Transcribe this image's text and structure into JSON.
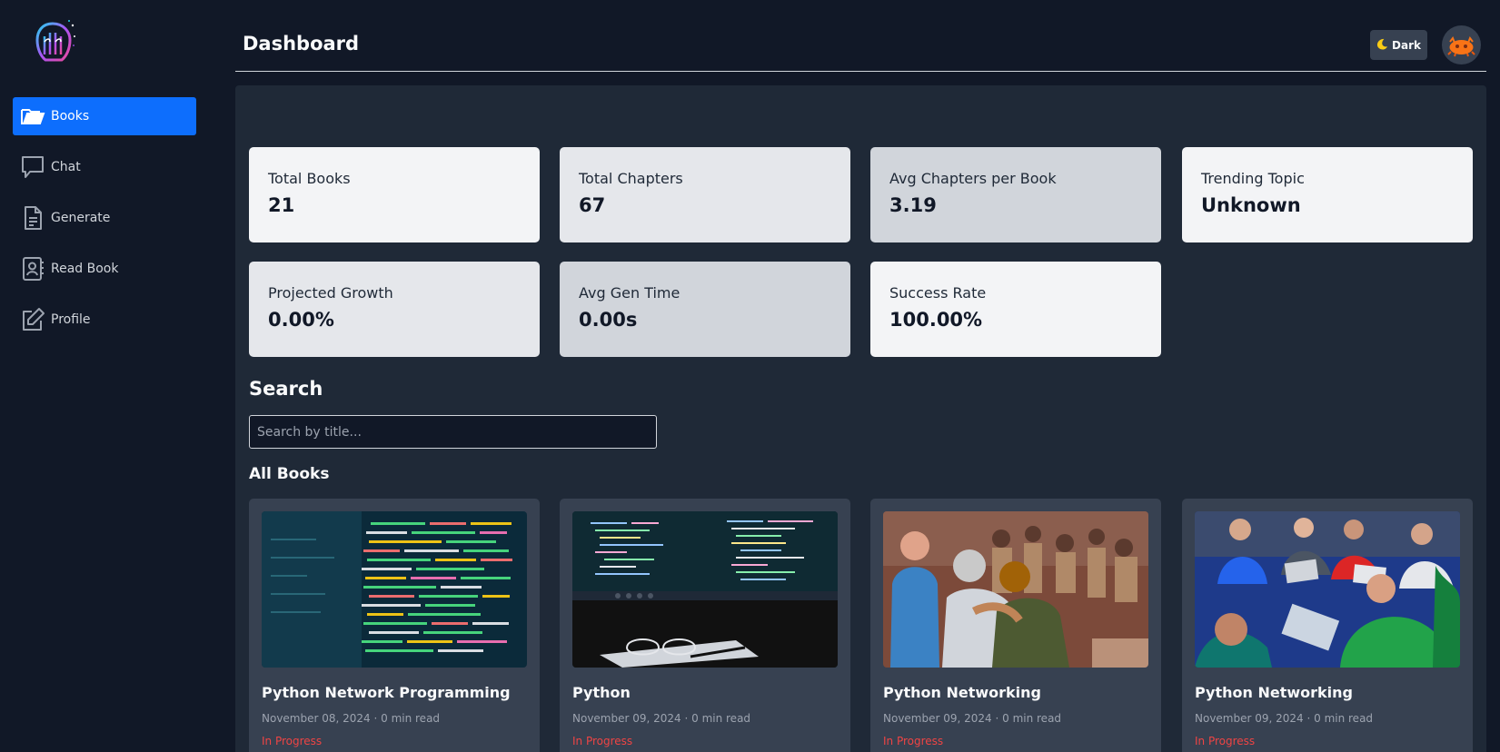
{
  "colors": {
    "accent": "#0d6efd",
    "status_in_progress": "#ef4444",
    "background": "#111827",
    "panel": "#1f2937"
  },
  "sidebar": {
    "logo_icon": "brain-circuit-logo",
    "items": [
      {
        "label": "Books",
        "icon": "folder-open-icon",
        "active": true
      },
      {
        "label": "Chat",
        "icon": "chat-bubble-icon"
      },
      {
        "label": "Generate",
        "icon": "document-icon"
      },
      {
        "label": "Read Book",
        "icon": "contact-book-icon"
      },
      {
        "label": "Profile",
        "icon": "edit-square-icon"
      }
    ]
  },
  "header": {
    "title": "Dashboard",
    "theme_toggle_label": "Dark",
    "theme_toggle_icon": "moon-icon"
  },
  "stats": [
    {
      "label": "Total Books",
      "value": "21"
    },
    {
      "label": "Total Chapters",
      "value": "67"
    },
    {
      "label": "Avg Chapters per Book",
      "value": "3.19"
    },
    {
      "label": "Trending Topic",
      "value": "Unknown"
    },
    {
      "label": "Projected Growth",
      "value": "0.00%"
    },
    {
      "label": "Avg Gen Time",
      "value": "0.00s"
    },
    {
      "label": "Success Rate",
      "value": "100.00%"
    }
  ],
  "search": {
    "heading": "Search",
    "placeholder": "Search by title...",
    "value": ""
  },
  "books": {
    "heading": "All Books",
    "items": [
      {
        "title": "Python Network Programming",
        "meta": "November 08, 2024 · 0 min read",
        "status": "In Progress"
      },
      {
        "title": "Python",
        "meta": "November 09, 2024 · 0 min read",
        "status": "In Progress"
      },
      {
        "title": "Python Networking",
        "meta": "November 09, 2024 · 0 min read",
        "status": "In Progress"
      },
      {
        "title": "Python Networking",
        "meta": "November 09, 2024 · 0 min read",
        "status": "In Progress"
      }
    ]
  }
}
